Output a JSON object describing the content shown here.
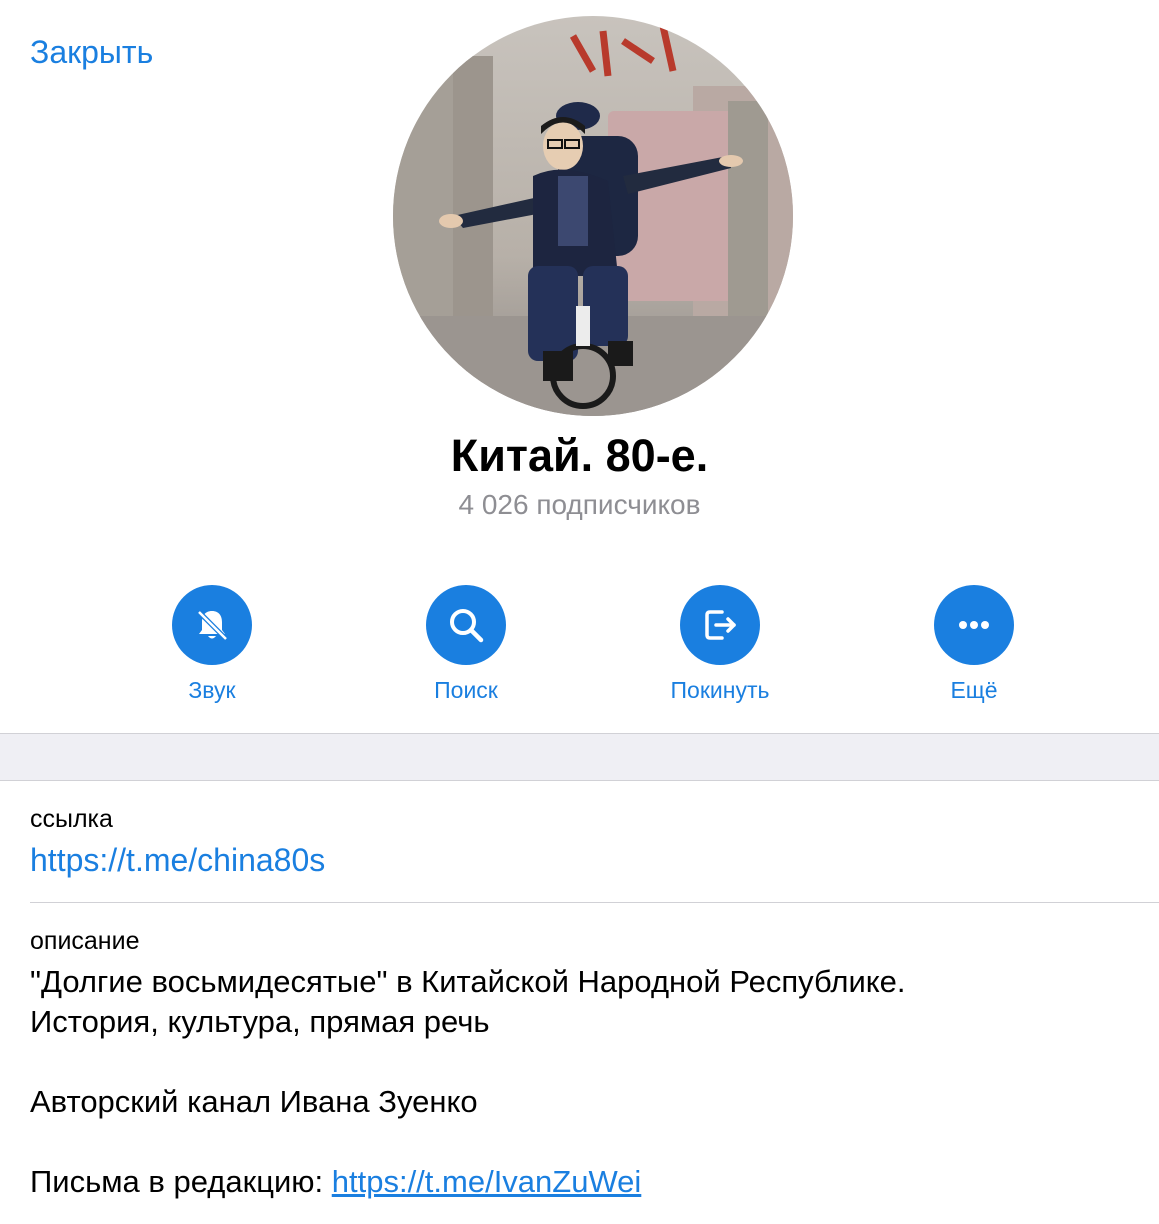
{
  "header": {
    "close_label": "Закрыть"
  },
  "channel": {
    "title": "Китай. 80-е.",
    "subscribers": "4 026 подписчиков"
  },
  "actions": [
    {
      "label": "Звук",
      "icon": "bell-slash-icon"
    },
    {
      "label": "Поиск",
      "icon": "search-icon"
    },
    {
      "label": "Покинуть",
      "icon": "leave-icon"
    },
    {
      "label": "Ещё",
      "icon": "more-dots-icon"
    }
  ],
  "link_section": {
    "label": "ссылка",
    "url": "https://t.me/china80s"
  },
  "description_section": {
    "label": "описание",
    "line1": "\"Долгие восьмидесятые\" в Китайской Народной Республике.",
    "line2": "История, культура, прямая речь",
    "author": "Авторский канал Ивана Зуенко",
    "mail_prefix": "Письма в редакцию: ",
    "mail_link": "https://t.me/IvanZuWei"
  },
  "colors": {
    "accent": "#1a7fe0",
    "secondary_text": "#8e8e93",
    "band": "#efeff4"
  }
}
